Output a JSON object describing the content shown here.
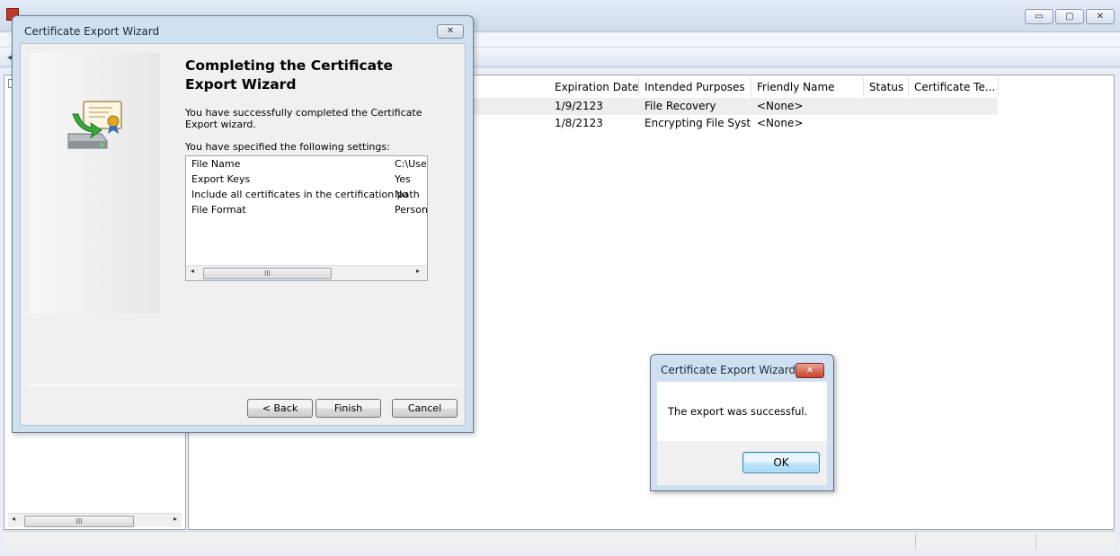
{
  "mmc": {
    "title": "",
    "window_buttons": {
      "minimize": "▭",
      "maximize": "▢",
      "close": "✕"
    },
    "toolbar_back_icon": "◂",
    "list": {
      "columns": [
        "Expiration Date",
        "Intended Purposes",
        "Friendly Name",
        "Status",
        "Certificate Te..."
      ],
      "rows": [
        {
          "expiration": "1/9/2123",
          "purposes": "File Recovery",
          "friendly": "<None>",
          "status": "",
          "template": ""
        },
        {
          "expiration": "1/8/2123",
          "purposes": "Encrypting File Syst...",
          "friendly": "<None>",
          "status": "",
          "template": ""
        }
      ]
    },
    "tree_scroll": {
      "left": "◂",
      "right": "▸",
      "thumb": "III"
    }
  },
  "wizard": {
    "title": "Certificate Export Wizard",
    "close_glyph": "✕",
    "heading": "Completing the Certificate Export Wizard",
    "description": "You have successfully completed the Certificate Export wizard.",
    "settings_label": "You have specified the following settings:",
    "settings": [
      {
        "name": "File Name",
        "value": "C:\\User"
      },
      {
        "name": "Export Keys",
        "value": "Yes"
      },
      {
        "name": "Include all certificates in the certification path",
        "value": "No"
      },
      {
        "name": "File Format",
        "value": "Persona"
      }
    ],
    "settings_scroll": {
      "left": "◂",
      "right": "▸",
      "thumb": "III"
    },
    "buttons": {
      "back": "< Back",
      "finish": "Finish",
      "cancel": "Cancel"
    }
  },
  "message_box": {
    "title": "Certificate Export Wizard",
    "close_glyph": "✕",
    "message": "The export was successful.",
    "ok": "OK"
  }
}
